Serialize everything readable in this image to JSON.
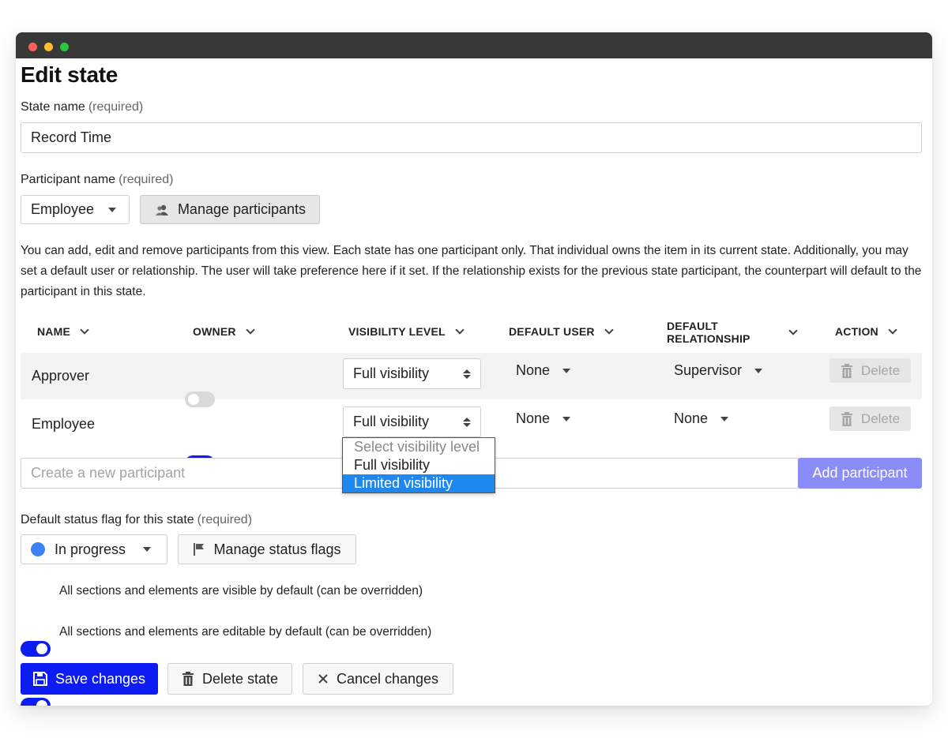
{
  "title": "Edit state",
  "state_name": {
    "label": "State name",
    "required": "(required)",
    "value": "Record Time"
  },
  "participant": {
    "label": "Participant name",
    "required": "(required)",
    "selected": "Employee",
    "manage_button": "Manage participants"
  },
  "description": "You can add, edit and remove participants from this view. Each state has one participant only. That individual owns the item in its current state. Additionally, you may set a default user or relationship. The user will take preference here if it set. If the relationship exists for the previous state participant, the counterpart will default to the participant in this state.",
  "table": {
    "headers": {
      "name": "NAME",
      "owner": "OWNER",
      "visibility": "VISIBILITY LEVEL",
      "default_user": "DEFAULT USER",
      "default_relationship_1": "DEFAULT",
      "default_relationship_2": "RELATIONSHIP",
      "action": "ACTION"
    },
    "rows": [
      {
        "name": "Approver",
        "owner": false,
        "visibility": "Full visibility",
        "default_user": "None",
        "default_relationship": "Supervisor",
        "action": "Delete"
      },
      {
        "name": "Employee",
        "owner": true,
        "visibility": "Full visibility",
        "default_user": "None",
        "default_relationship": "None",
        "action": "Delete"
      }
    ]
  },
  "visibility_dropdown": {
    "options": [
      "Select visibility level",
      "Full visibility",
      "Limited visibility"
    ],
    "highlighted": "Limited visibility"
  },
  "new_participant": {
    "placeholder": "Create a new participant",
    "button": "Add participant"
  },
  "status_flag": {
    "label": "Default status flag for this state",
    "required": "(required)",
    "selected": "In progress",
    "selected_color": "#3b82f6",
    "manage_button": "Manage status flags"
  },
  "toggles": [
    {
      "label": "All sections and elements are visible by default (can be overridden)",
      "on": true
    },
    {
      "label": "All sections and elements are editable by default (can be overridden)",
      "on": true
    }
  ],
  "actions": {
    "save": "Save changes",
    "delete": "Delete state",
    "cancel": "Cancel changes"
  },
  "colors": {
    "primary": "#0d1cf2",
    "add_button": "#8a8cf7",
    "highlight": "#1e88f0"
  }
}
